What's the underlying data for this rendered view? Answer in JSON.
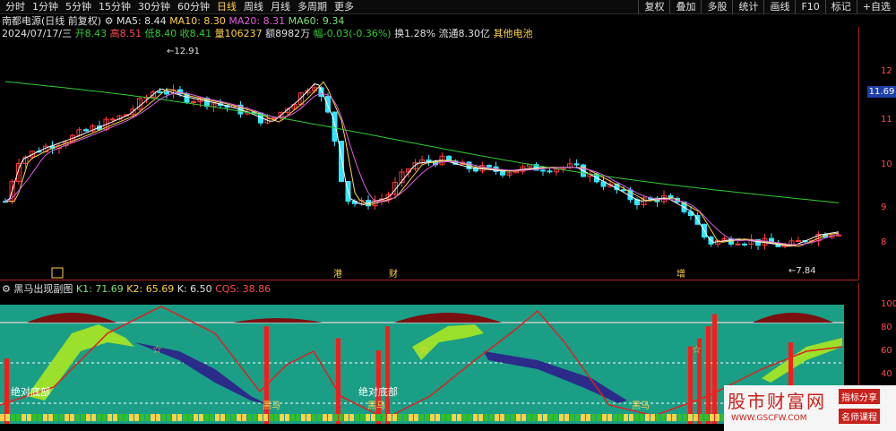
{
  "toolbar": {
    "periods": [
      "分时",
      "1分钟",
      "5分钟",
      "15分钟",
      "30分钟",
      "60分钟",
      "日线",
      "周线",
      "月线",
      "多周期",
      "更多"
    ],
    "active_period": "日线",
    "right_buttons": [
      "复权",
      "叠加",
      "多股",
      "统计",
      "画线",
      "F10",
      "标记",
      "+自选"
    ]
  },
  "header": {
    "stock_name": "南都电源(日线 前复权)",
    "ma5": "MA5: 8.44",
    "ma10": "MA10: 8.30",
    "ma20": "MA20: 8.31",
    "ma60": "MA60: 9.34",
    "date": "2024/07/17/三",
    "open": "开8.43",
    "high": "高8.51",
    "low": "低8.40",
    "close": "收8.41",
    "volume": "量106237",
    "amount": "额8982万",
    "change": "幅-0.03(-0.36%)",
    "turnover": "换1.28%",
    "float": "流通8.30亿",
    "sector": "其他电池"
  },
  "main_chart": {
    "y_axis_ticks": [
      "12",
      "11",
      "10",
      "9",
      "8"
    ],
    "current_price_box": "11.69",
    "high_marker": "12.91",
    "low_marker": "7.84",
    "event_tags": [
      "港",
      "财",
      "增"
    ],
    "colors": {
      "up": "#ff3a3a",
      "down": "#33e6ff",
      "ma5": "#ffffff",
      "ma10": "#ffd24a",
      "ma20": "#e060e0",
      "ma60": "#33cc33"
    }
  },
  "indicator": {
    "name": "黑马出现副图",
    "k1": "K1: 71.69",
    "k2": "K2: 65.69",
    "k": "K: 6.50",
    "cqs": "CQS: 38.86",
    "y_axis_ticks": [
      "100",
      "80",
      "60",
      "40"
    ],
    "bottom_labels": [
      "绝对底部",
      "绝对底部"
    ],
    "signal_labels": [
      "黑马",
      "黑马",
      "黑马"
    ]
  },
  "watermark": {
    "title": "股市财富网",
    "url": "WWW.GSCFW.COM",
    "tag1": "指标分享",
    "tag2": "名师课程"
  }
}
